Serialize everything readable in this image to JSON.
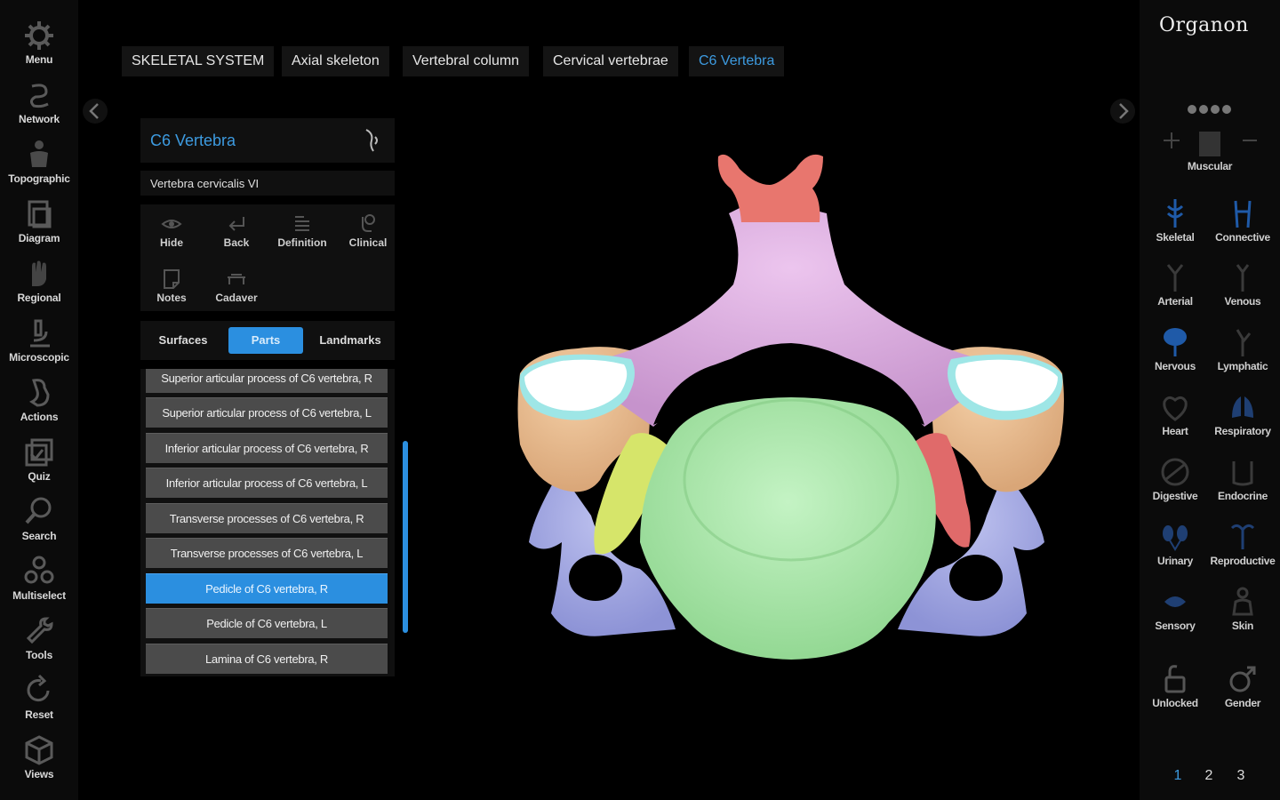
{
  "app": {
    "logo": "Organon"
  },
  "left_sidebar": {
    "items": [
      {
        "label": "Menu",
        "icon": "gear-icon"
      },
      {
        "label": "Network",
        "icon": "network-icon"
      },
      {
        "label": "Topographic",
        "icon": "topographic-icon"
      },
      {
        "label": "Diagram",
        "icon": "diagram-icon"
      },
      {
        "label": "Regional",
        "icon": "regional-icon"
      },
      {
        "label": "Microscopic",
        "icon": "microscope-icon"
      },
      {
        "label": "Actions",
        "icon": "actions-icon"
      },
      {
        "label": "Quiz",
        "icon": "quiz-icon"
      },
      {
        "label": "Search",
        "icon": "search-icon"
      },
      {
        "label": "Multiselect",
        "icon": "multiselect-icon"
      },
      {
        "label": "Tools",
        "icon": "wrench-icon"
      },
      {
        "label": "Reset",
        "icon": "reset-icon"
      },
      {
        "label": "Views",
        "icon": "cube-icon"
      }
    ]
  },
  "breadcrumb": [
    "SKELETAL SYSTEM",
    "Axial skeleton",
    "Vertebral column",
    "Cervical vertebrae",
    "C6 Vertebra"
  ],
  "panel": {
    "title": "C6 Vertebra",
    "latin": "Vertebra cervicalis VI",
    "tools": [
      {
        "label": "Hide",
        "icon": "eye-icon"
      },
      {
        "label": "Back",
        "icon": "back-icon"
      },
      {
        "label": "Definition",
        "icon": "definition-icon"
      },
      {
        "label": "Clinical",
        "icon": "clinical-icon"
      },
      {
        "label": "Notes",
        "icon": "notes-icon"
      },
      {
        "label": "Cadaver",
        "icon": "cadaver-icon"
      }
    ],
    "tabs": [
      {
        "label": "Surfaces",
        "active": false
      },
      {
        "label": "Parts",
        "active": true
      },
      {
        "label": "Landmarks",
        "active": false
      }
    ],
    "parts": [
      {
        "label": "Superior articular process of C6 vertebra, R",
        "selected": false
      },
      {
        "label": "Superior articular process of C6 vertebra, L",
        "selected": false
      },
      {
        "label": "Inferior articular process of C6 vertebra, R",
        "selected": false
      },
      {
        "label": "Inferior articular process of C6 vertebra, L",
        "selected": false
      },
      {
        "label": "Transverse processes of C6 vertebra, R",
        "selected": false
      },
      {
        "label": "Transverse processes of C6 vertebra, L",
        "selected": false
      },
      {
        "label": "Pedicle of C6 vertebra, R",
        "selected": true
      },
      {
        "label": "Pedicle of C6 vertebra, L",
        "selected": false
      },
      {
        "label": "Lamina of C6 vertebra, R",
        "selected": false
      }
    ]
  },
  "right_sidebar": {
    "layer_label": "Muscular",
    "systems": [
      {
        "label": "Skeletal",
        "icon": "skeletal-icon",
        "color": "#1f5aa8"
      },
      {
        "label": "Connective",
        "icon": "connective-icon",
        "color": "#1f5aa8"
      },
      {
        "label": "Arterial",
        "icon": "arterial-icon",
        "color": "#3a3a3a"
      },
      {
        "label": "Venous",
        "icon": "venous-icon",
        "color": "#3a3a3a"
      },
      {
        "label": "Nervous",
        "icon": "nervous-icon",
        "color": "#1f5aa8"
      },
      {
        "label": "Lymphatic",
        "icon": "lymphatic-icon",
        "color": "#3a3a3a"
      },
      {
        "label": "Heart",
        "icon": "heart-icon",
        "color": "#3a3a3a"
      },
      {
        "label": "Respiratory",
        "icon": "respiratory-icon",
        "color": "#1f5aa8"
      },
      {
        "label": "Digestive",
        "icon": "digestive-icon",
        "color": "#3a3a3a"
      },
      {
        "label": "Endocrine",
        "icon": "endocrine-icon",
        "color": "#3a3a3a"
      },
      {
        "label": "Urinary",
        "icon": "urinary-icon",
        "color": "#1f5aa8"
      },
      {
        "label": "Reproductive",
        "icon": "reproductive-icon",
        "color": "#1f5aa8"
      },
      {
        "label": "Sensory",
        "icon": "sensory-icon",
        "color": "#1f5aa8"
      },
      {
        "label": "Skin",
        "icon": "skin-icon",
        "color": "#3a3a3a"
      }
    ],
    "unlocked_label": "Unlocked",
    "gender_label": "Gender",
    "pages": [
      "1",
      "2",
      "3"
    ],
    "active_page": "1"
  },
  "colors": {
    "accent": "#2b8fe0",
    "spinous": "#e8766e",
    "lamina": "#e2b2e6",
    "articular": "#f0c49a",
    "body": "#b3ebb3",
    "transverse": "#a9aee6",
    "pedicle_r": "#d6e56a",
    "pedicle_l": "#e06a6a",
    "facet": "#ffffff",
    "facet_rim": "#9ee6e6"
  }
}
